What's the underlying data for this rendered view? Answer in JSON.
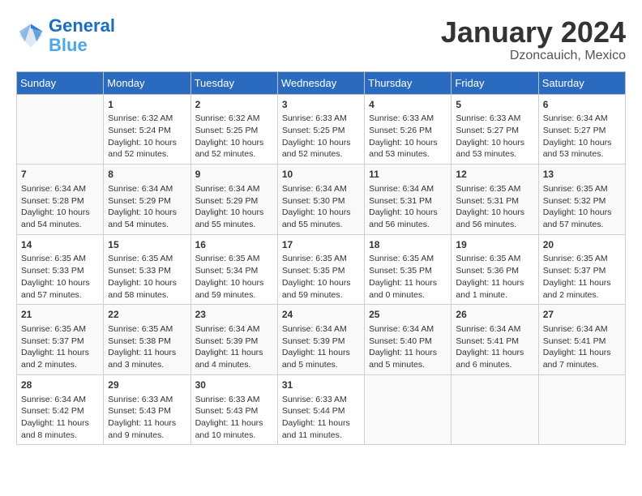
{
  "header": {
    "logo_line1": "General",
    "logo_line2": "Blue",
    "month": "January 2024",
    "location": "Dzoncauich, Mexico"
  },
  "columns": [
    "Sunday",
    "Monday",
    "Tuesday",
    "Wednesday",
    "Thursday",
    "Friday",
    "Saturday"
  ],
  "weeks": [
    [
      {
        "day": "",
        "text": ""
      },
      {
        "day": "1",
        "text": "Sunrise: 6:32 AM\nSunset: 5:24 PM\nDaylight: 10 hours\nand 52 minutes."
      },
      {
        "day": "2",
        "text": "Sunrise: 6:32 AM\nSunset: 5:25 PM\nDaylight: 10 hours\nand 52 minutes."
      },
      {
        "day": "3",
        "text": "Sunrise: 6:33 AM\nSunset: 5:25 PM\nDaylight: 10 hours\nand 52 minutes."
      },
      {
        "day": "4",
        "text": "Sunrise: 6:33 AM\nSunset: 5:26 PM\nDaylight: 10 hours\nand 53 minutes."
      },
      {
        "day": "5",
        "text": "Sunrise: 6:33 AM\nSunset: 5:27 PM\nDaylight: 10 hours\nand 53 minutes."
      },
      {
        "day": "6",
        "text": "Sunrise: 6:34 AM\nSunset: 5:27 PM\nDaylight: 10 hours\nand 53 minutes."
      }
    ],
    [
      {
        "day": "7",
        "text": "Sunrise: 6:34 AM\nSunset: 5:28 PM\nDaylight: 10 hours\nand 54 minutes."
      },
      {
        "day": "8",
        "text": "Sunrise: 6:34 AM\nSunset: 5:29 PM\nDaylight: 10 hours\nand 54 minutes."
      },
      {
        "day": "9",
        "text": "Sunrise: 6:34 AM\nSunset: 5:29 PM\nDaylight: 10 hours\nand 55 minutes."
      },
      {
        "day": "10",
        "text": "Sunrise: 6:34 AM\nSunset: 5:30 PM\nDaylight: 10 hours\nand 55 minutes."
      },
      {
        "day": "11",
        "text": "Sunrise: 6:34 AM\nSunset: 5:31 PM\nDaylight: 10 hours\nand 56 minutes."
      },
      {
        "day": "12",
        "text": "Sunrise: 6:35 AM\nSunset: 5:31 PM\nDaylight: 10 hours\nand 56 minutes."
      },
      {
        "day": "13",
        "text": "Sunrise: 6:35 AM\nSunset: 5:32 PM\nDaylight: 10 hours\nand 57 minutes."
      }
    ],
    [
      {
        "day": "14",
        "text": "Sunrise: 6:35 AM\nSunset: 5:33 PM\nDaylight: 10 hours\nand 57 minutes."
      },
      {
        "day": "15",
        "text": "Sunrise: 6:35 AM\nSunset: 5:33 PM\nDaylight: 10 hours\nand 58 minutes."
      },
      {
        "day": "16",
        "text": "Sunrise: 6:35 AM\nSunset: 5:34 PM\nDaylight: 10 hours\nand 59 minutes."
      },
      {
        "day": "17",
        "text": "Sunrise: 6:35 AM\nSunset: 5:35 PM\nDaylight: 10 hours\nand 59 minutes."
      },
      {
        "day": "18",
        "text": "Sunrise: 6:35 AM\nSunset: 5:35 PM\nDaylight: 11 hours\nand 0 minutes."
      },
      {
        "day": "19",
        "text": "Sunrise: 6:35 AM\nSunset: 5:36 PM\nDaylight: 11 hours\nand 1 minute."
      },
      {
        "day": "20",
        "text": "Sunrise: 6:35 AM\nSunset: 5:37 PM\nDaylight: 11 hours\nand 2 minutes."
      }
    ],
    [
      {
        "day": "21",
        "text": "Sunrise: 6:35 AM\nSunset: 5:37 PM\nDaylight: 11 hours\nand 2 minutes."
      },
      {
        "day": "22",
        "text": "Sunrise: 6:35 AM\nSunset: 5:38 PM\nDaylight: 11 hours\nand 3 minutes."
      },
      {
        "day": "23",
        "text": "Sunrise: 6:34 AM\nSunset: 5:39 PM\nDaylight: 11 hours\nand 4 minutes."
      },
      {
        "day": "24",
        "text": "Sunrise: 6:34 AM\nSunset: 5:39 PM\nDaylight: 11 hours\nand 5 minutes."
      },
      {
        "day": "25",
        "text": "Sunrise: 6:34 AM\nSunset: 5:40 PM\nDaylight: 11 hours\nand 5 minutes."
      },
      {
        "day": "26",
        "text": "Sunrise: 6:34 AM\nSunset: 5:41 PM\nDaylight: 11 hours\nand 6 minutes."
      },
      {
        "day": "27",
        "text": "Sunrise: 6:34 AM\nSunset: 5:41 PM\nDaylight: 11 hours\nand 7 minutes."
      }
    ],
    [
      {
        "day": "28",
        "text": "Sunrise: 6:34 AM\nSunset: 5:42 PM\nDaylight: 11 hours\nand 8 minutes."
      },
      {
        "day": "29",
        "text": "Sunrise: 6:33 AM\nSunset: 5:43 PM\nDaylight: 11 hours\nand 9 minutes."
      },
      {
        "day": "30",
        "text": "Sunrise: 6:33 AM\nSunset: 5:43 PM\nDaylight: 11 hours\nand 10 minutes."
      },
      {
        "day": "31",
        "text": "Sunrise: 6:33 AM\nSunset: 5:44 PM\nDaylight: 11 hours\nand 11 minutes."
      },
      {
        "day": "",
        "text": ""
      },
      {
        "day": "",
        "text": ""
      },
      {
        "day": "",
        "text": ""
      }
    ]
  ]
}
